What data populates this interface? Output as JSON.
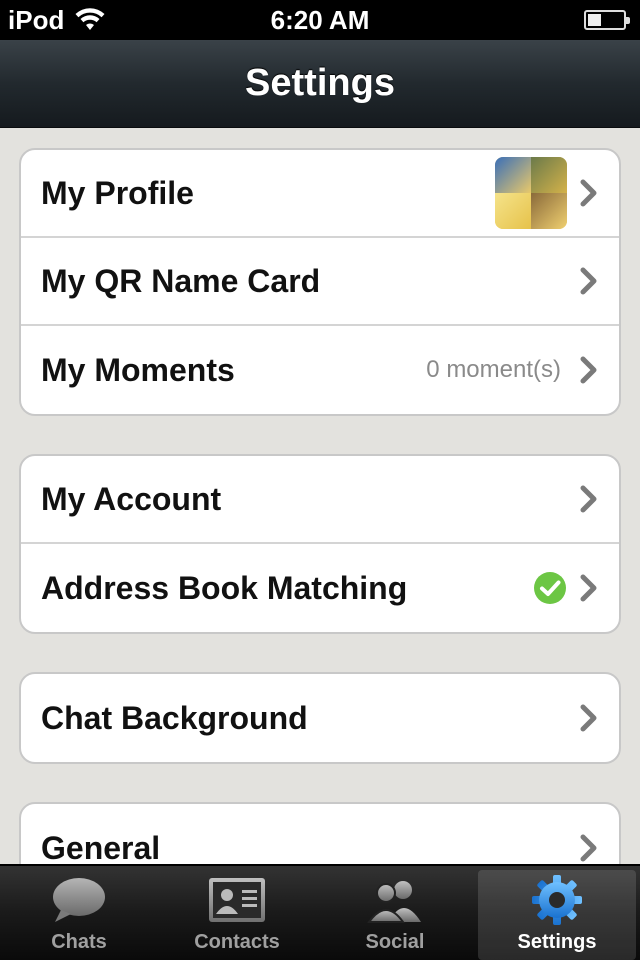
{
  "status_bar": {
    "carrier": "iPod",
    "time": "6:20 AM"
  },
  "nav": {
    "title": "Settings"
  },
  "groups": [
    {
      "rows": [
        {
          "label": "My Profile"
        },
        {
          "label": "My QR Name Card"
        },
        {
          "label": "My Moments",
          "value": "0 moment(s)"
        }
      ]
    },
    {
      "rows": [
        {
          "label": "My Account"
        },
        {
          "label": "Address Book Matching"
        }
      ]
    },
    {
      "rows": [
        {
          "label": "Chat Background"
        }
      ]
    },
    {
      "rows": [
        {
          "label": "General"
        }
      ]
    }
  ],
  "tabs": [
    {
      "label": "Chats",
      "icon": "chat-bubble-icon"
    },
    {
      "label": "Contacts",
      "icon": "contact-card-icon"
    },
    {
      "label": "Social",
      "icon": "people-icon"
    },
    {
      "label": "Settings",
      "icon": "gear-icon",
      "active": true
    }
  ],
  "colors": {
    "accent": "#2e8ee0",
    "check_green": "#6cc644",
    "nav_bg": "#22292e"
  }
}
